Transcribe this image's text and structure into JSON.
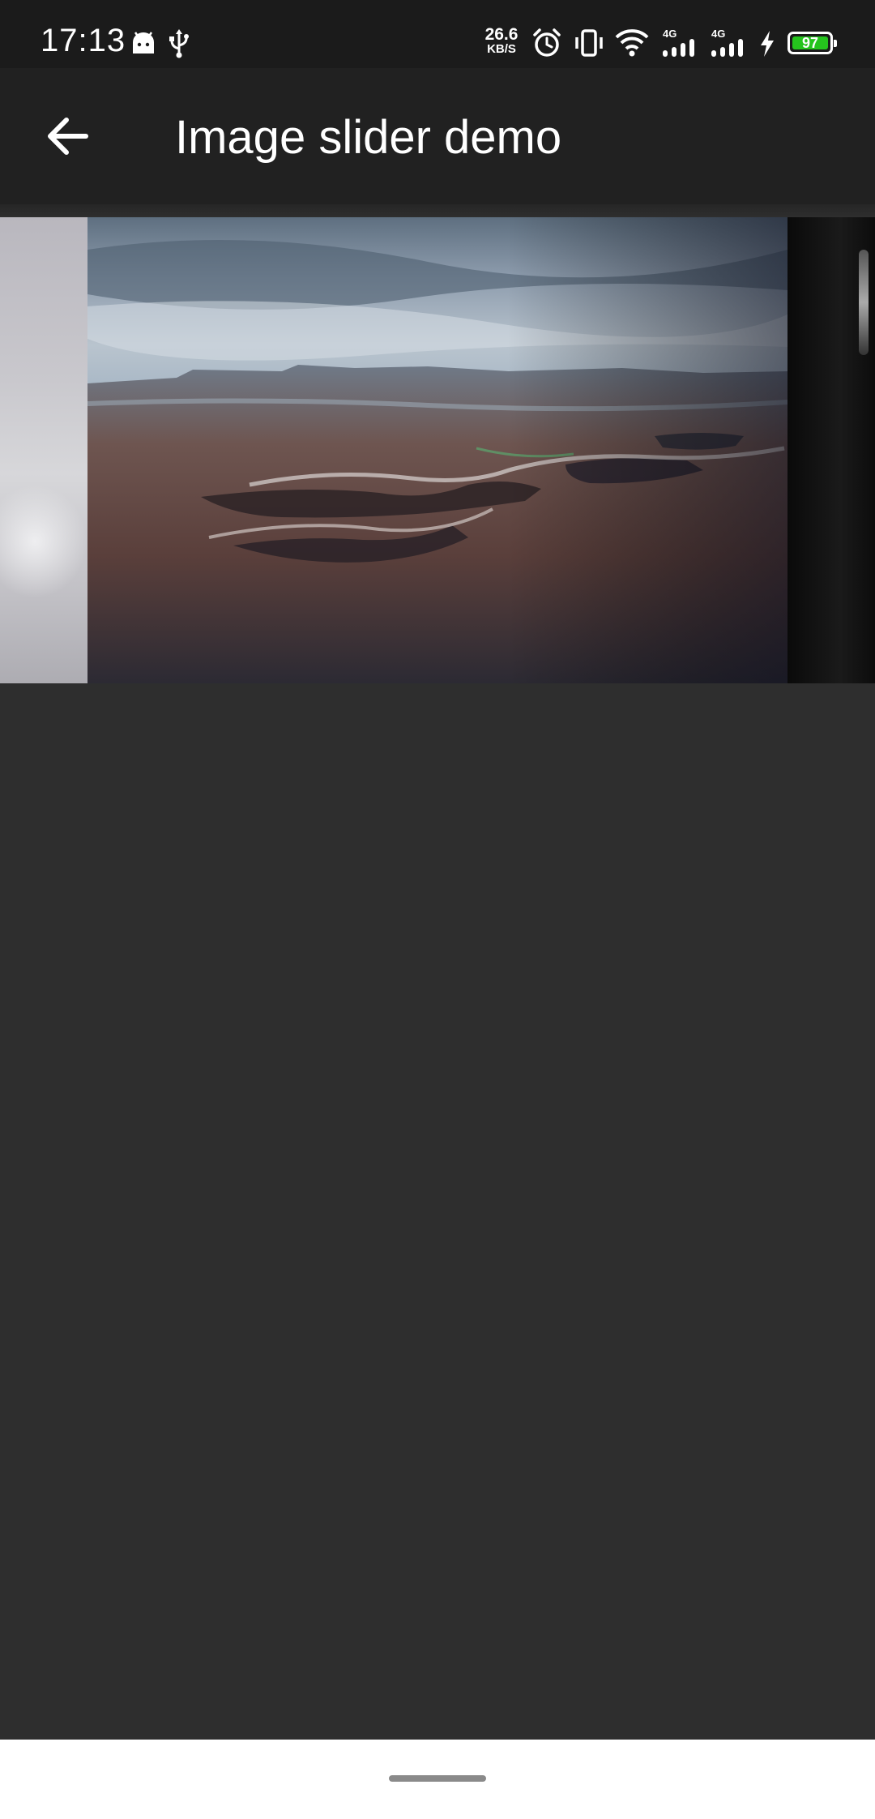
{
  "status_bar": {
    "time": "17:13",
    "net_speed_value": "26.6",
    "net_speed_unit": "KB/S",
    "signal_1_label": "4G",
    "signal_2_label": "4G",
    "battery_level": "97",
    "battery_color": "#25c41d",
    "icons": [
      "android-icon",
      "usb-icon",
      "alarm-icon",
      "vibrate-icon",
      "wifi-icon",
      "signal-icon",
      "signal-icon",
      "charging-icon",
      "battery-icon"
    ]
  },
  "app_bar": {
    "title": "Image slider demo",
    "back_icon": "arrow-left-icon",
    "background": "#212121"
  },
  "slider": {
    "slides": [
      "cloudy-sky-image",
      "canyon-landscape-image",
      "dark-monochrome-image"
    ],
    "current_index": 1
  },
  "colors": {
    "page_background": "#2e2e2e",
    "status_bar": "#1b1b1b",
    "nav_bar": "#ffffff"
  }
}
